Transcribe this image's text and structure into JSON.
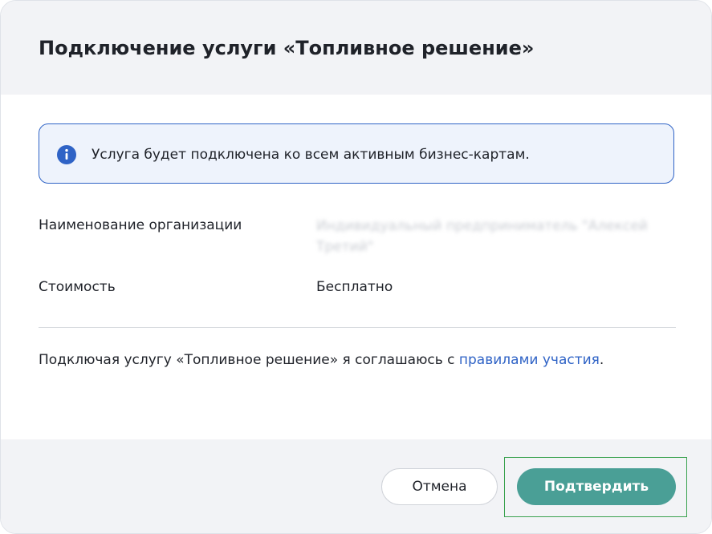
{
  "modal": {
    "title": "Подключение услуги «Топливное решение»"
  },
  "info_banner": {
    "icon": "info-icon",
    "text": "Услуга будет подключена ко всем активным бизнес-картам.",
    "accent_color": "#2f63c6"
  },
  "fields": {
    "organization": {
      "label": "Наименование организации",
      "value": "Индивидуальный предприниматель \"Алексей Третий\""
    },
    "cost": {
      "label": "Стоимость",
      "value": "Бесплатно"
    }
  },
  "consent": {
    "text": "Подключая услугу «Топливное решение» я соглашаюсь с ",
    "link_text": "правилами участия",
    "suffix": "."
  },
  "footer": {
    "cancel_label": "Отмена",
    "confirm_label": "Подтвердить",
    "confirm_color": "#4a9f96"
  }
}
